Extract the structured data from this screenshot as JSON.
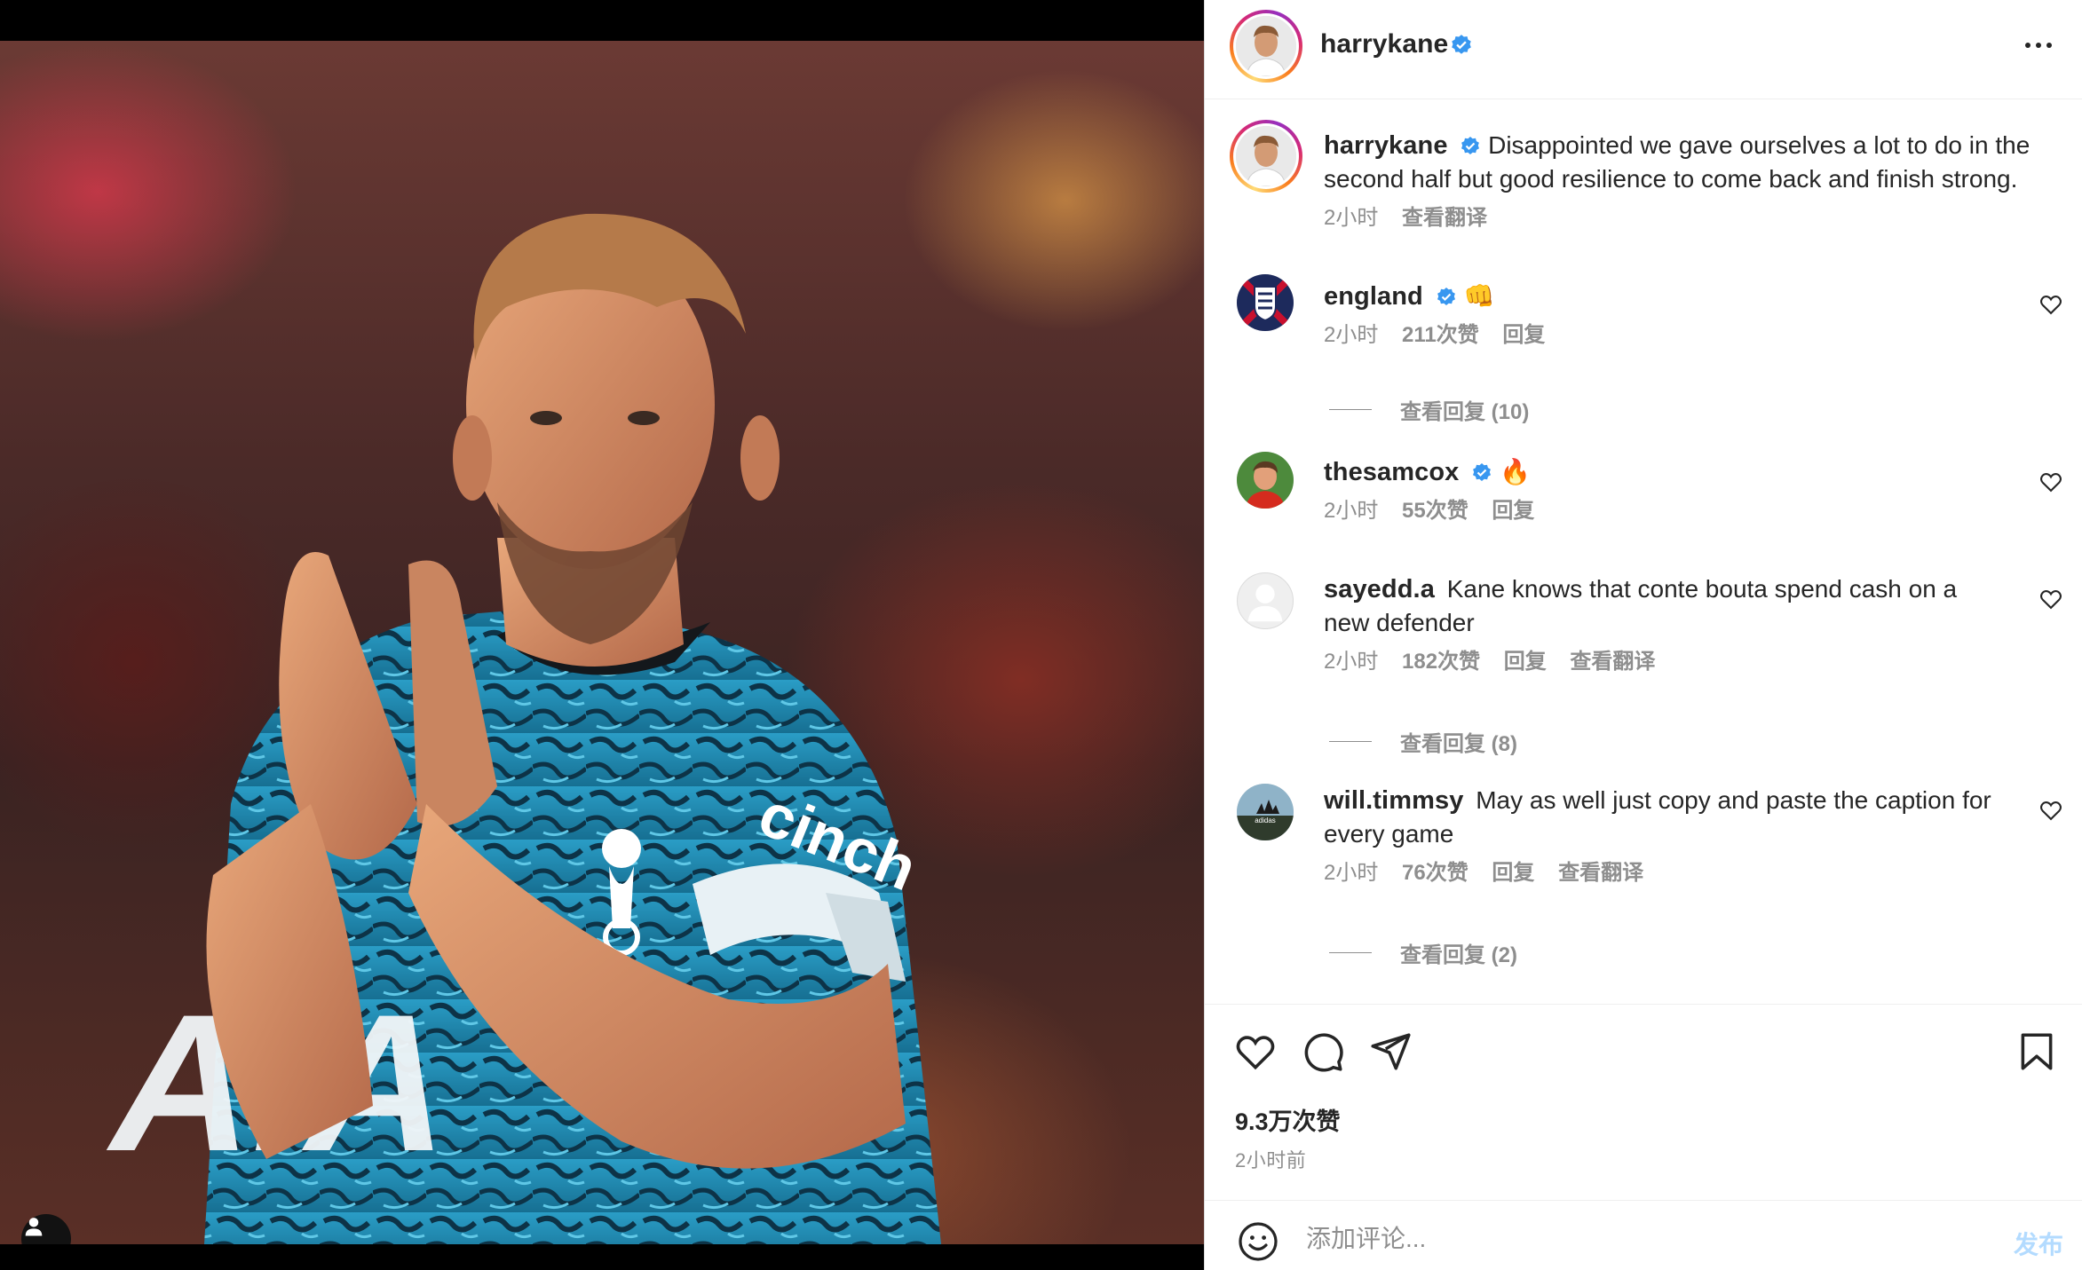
{
  "media": {
    "jersey_text": "cinch",
    "sponsor_text": "AIA"
  },
  "post": {
    "author": "harrykane",
    "caption_author": "harrykane",
    "caption": "Disappointed we gave ourselves a lot to do in the second half but good resilience to come back and finish strong.",
    "caption_time": "2小时",
    "caption_translate": "查看翻译"
  },
  "comments": [
    {
      "username": "england",
      "verified": true,
      "text": "👊",
      "time": "2小时",
      "likes": "211次赞",
      "reply": "回复",
      "translate": "",
      "view_replies": "查看回复 (10)"
    },
    {
      "username": "thesamcox",
      "verified": true,
      "text": "🔥",
      "time": "2小时",
      "likes": "55次赞",
      "reply": "回复",
      "translate": "",
      "view_replies": ""
    },
    {
      "username": "sayedd.a",
      "verified": false,
      "text": "Kane knows that conte bouta spend cash on a new defender",
      "time": "2小时",
      "likes": "182次赞",
      "reply": "回复",
      "translate": "查看翻译",
      "view_replies": "查看回复 (8)"
    },
    {
      "username": "will.timmsy",
      "verified": false,
      "text": "May as well just copy and paste the caption for every game",
      "time": "2小时",
      "likes": "76次赞",
      "reply": "回复",
      "translate": "查看翻译",
      "view_replies": "查看回复 (2)"
    }
  ],
  "actions": {
    "likes": "9.3万次赞",
    "time_ago": "2小时前"
  },
  "add_comment": {
    "placeholder": "添加评论...",
    "post_label": "发布"
  },
  "colors": {
    "verified": "#3897f0",
    "muted": "#8e8e8e",
    "post_button_disabled": "#b3dbff",
    "jersey_blue": "#1f8fb8"
  },
  "icons": [
    "verified-icon",
    "more-icon",
    "heart-icon",
    "comment-icon",
    "share-icon",
    "bookmark-icon",
    "emoji-icon",
    "user-icon"
  ]
}
